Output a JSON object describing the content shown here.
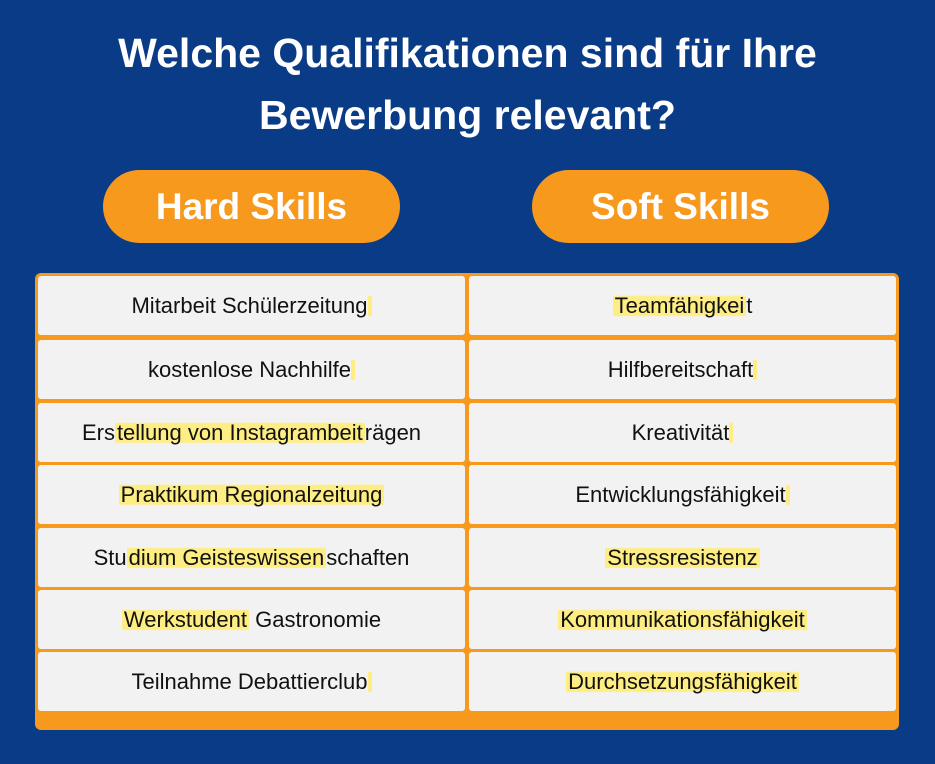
{
  "title": {
    "line1": "Welche Qualifikationen sind für Ihre",
    "line2": "Bewerbung relevant?"
  },
  "hard_skills": {
    "label": "Hard Skills",
    "items": [
      {
        "pre": "Mitarbeit Schülerzeitung",
        "hl": "",
        "post": ""
      },
      {
        "pre": "kostenlose Nachhilfe",
        "hl": "",
        "post": ""
      },
      {
        "pre": "Ers",
        "hl": "tellung von Instagrambeit",
        "post": "rägen"
      },
      {
        "pre": "",
        "hl": "Praktikum Regionalzeitung",
        "post": ""
      },
      {
        "pre": "Stu",
        "hl": "dium Geisteswissen",
        "post": "schaften"
      },
      {
        "pre": "",
        "hl": "Werkstudent",
        "post": " Gastronomie"
      },
      {
        "pre": "Teilnahme Debattierclub",
        "hl": "",
        "post": ""
      }
    ]
  },
  "soft_skills": {
    "label": "Soft Skills",
    "items": [
      {
        "pre": "",
        "hl": "Teamfähigkei",
        "post": "t"
      },
      {
        "pre": "Hilfbereitschaft",
        "hl": "",
        "post": ""
      },
      {
        "pre": "Kreativität",
        "hl": "",
        "post": ""
      },
      {
        "pre": "Entwicklungsfähigkeit",
        "hl": "",
        "post": ""
      },
      {
        "pre": "",
        "hl": "Stressresistenz",
        "post": ""
      },
      {
        "pre": "",
        "hl": "Kommunikationsfähigkeit",
        "post": ""
      },
      {
        "pre": "",
        "hl": "Durchsetzungsfähigkeit",
        "post": ""
      }
    ]
  },
  "colors": {
    "background": "#0a3b87",
    "accent": "#f7991d",
    "cell": "#f2f2f2",
    "highlight": "#ffec6e"
  }
}
